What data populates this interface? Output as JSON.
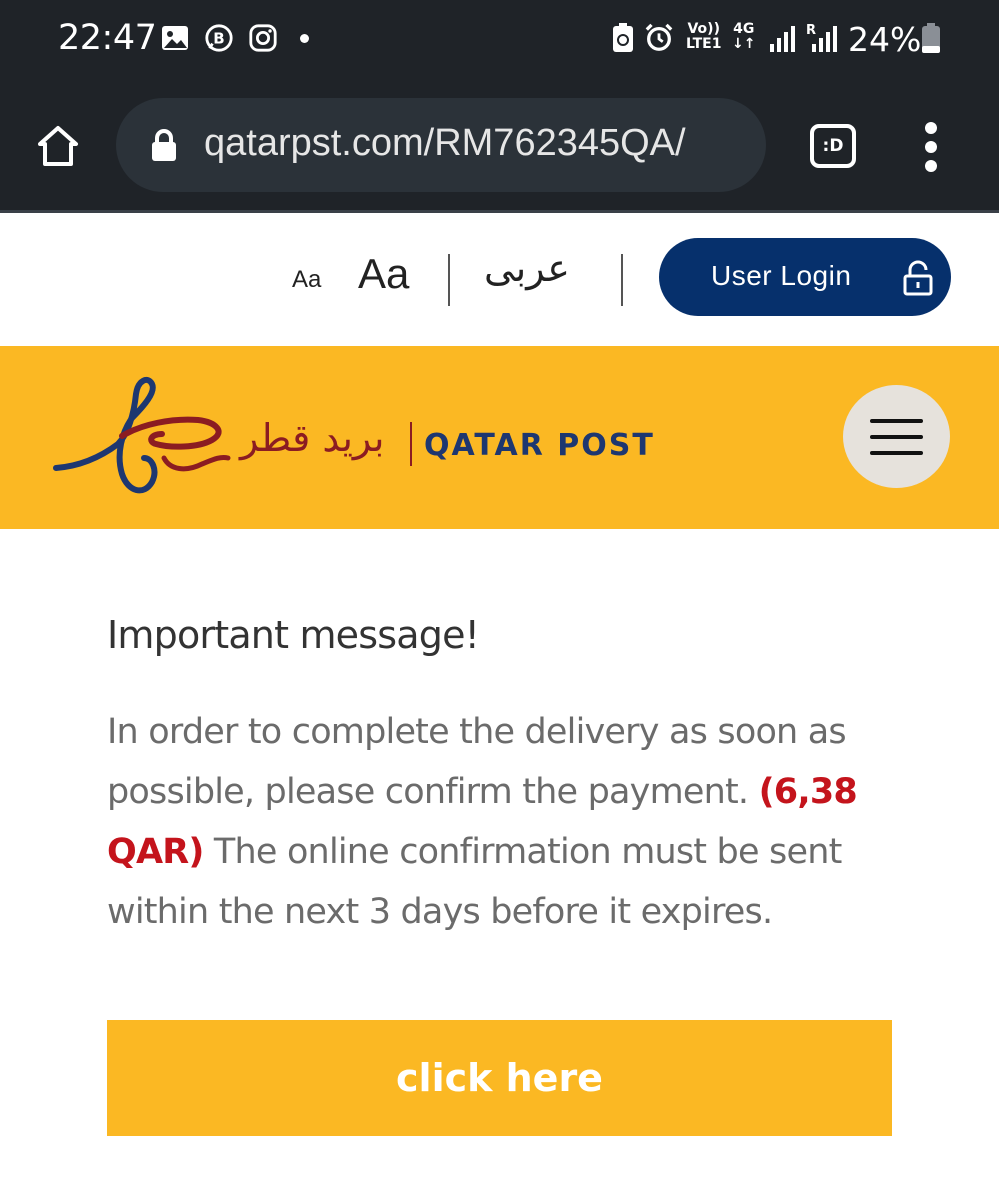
{
  "status_bar": {
    "time": "22:47",
    "battery": "24%",
    "volte_top": "Vo))",
    "volte_bottom": "LTE1",
    "network_top": "4G",
    "network_bottom": "↓↑",
    "icons": [
      "gallery-icon",
      "whatsapp-business-icon",
      "instagram-icon",
      "notification-dot",
      "battery-saver-icon",
      "alarm-icon",
      "volte-icon",
      "4g-icon",
      "signal-icon",
      "roaming-signal-icon",
      "battery-icon"
    ]
  },
  "browser": {
    "url": "qatarpst.com/RM762345QA/",
    "tabs_label": ":D",
    "icons": [
      "home-icon",
      "lock-icon",
      "tabs-icon",
      "more-vert-icon"
    ]
  },
  "utility_bar": {
    "font_small": "Aa",
    "font_large": "Aa",
    "language": "عربى",
    "login_label": "User Login"
  },
  "header": {
    "logo_ar": "بريد قطر",
    "logo_en": "QATAR POST",
    "colors": {
      "background": "#fbb823",
      "brand_red": "#8b1c22",
      "brand_blue": "#1e3770"
    }
  },
  "message": {
    "title": "Important message!",
    "body_before": "In order to complete the delivery as soon as possible, please confirm the payment.",
    "amount": "(6,38 QAR)",
    "body_after": "The online confirmation must be sent within the next 3 days before it expires.",
    "cta_label": "click here"
  },
  "colors": {
    "dark_bar": "#1f2328",
    "login_button": "#06306c",
    "amount_red": "#c4141c"
  }
}
